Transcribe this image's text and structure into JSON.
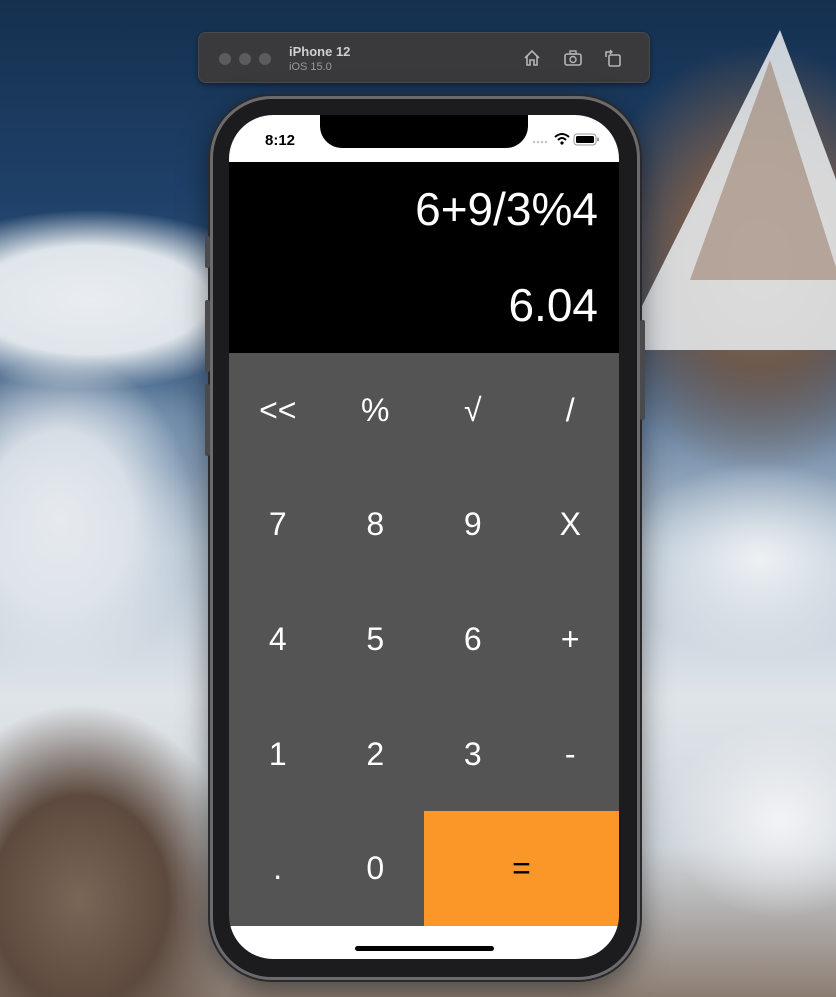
{
  "simulator": {
    "device": "iPhone 12",
    "os": "iOS 15.0",
    "icons": [
      "home-icon",
      "screenshot-icon",
      "rotate-icon"
    ]
  },
  "status_bar": {
    "time": "8:12",
    "icons": [
      "cellular-icon",
      "wifi-icon",
      "battery-icon"
    ]
  },
  "display": {
    "expression": "6+9/3%4",
    "result": "6.04"
  },
  "keypad": {
    "rows": [
      [
        "<<",
        "%",
        "√",
        "/"
      ],
      [
        "7",
        "8",
        "9",
        "X"
      ],
      [
        "4",
        "5",
        "6",
        "+"
      ],
      [
        "1",
        "2",
        "3",
        "-"
      ],
      [
        ".",
        "0",
        "="
      ]
    ],
    "colors": {
      "keypad_bg": "#545454",
      "equals_bg": "#fb9628",
      "display_bg": "#000000"
    }
  }
}
